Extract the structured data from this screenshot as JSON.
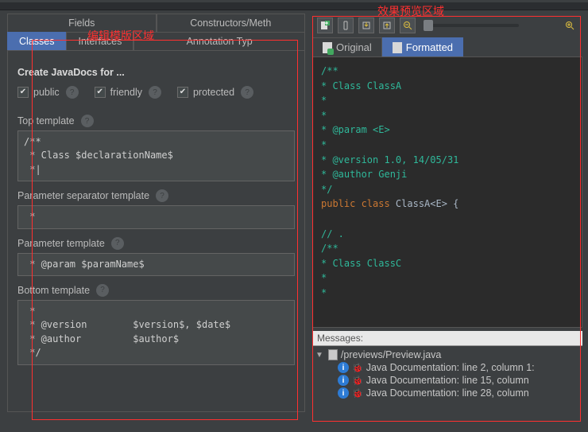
{
  "annotations": {
    "left": "编辑模版区域",
    "right": "效果预览区域"
  },
  "leftTabsRow1": {
    "fields": "Fields",
    "constructors": "Constructors/Meth"
  },
  "leftTabsRow2": {
    "classes": "Classes",
    "interfaces": "Interfaces",
    "annotation": "Annotation Typ"
  },
  "form": {
    "heading": "Create JavaDocs for ...",
    "checks": {
      "public": "public",
      "friendly": "friendly",
      "protected": "protected"
    },
    "labels": {
      "top": "Top template",
      "paramSep": "Parameter separator template",
      "param": "Parameter template",
      "bottom": "Bottom template"
    },
    "code": {
      "top": "/**\n * Class $declarationName$\n *|",
      "paramSep": " *",
      "param": " * @param $paramName$",
      "bottom": " *\n * @version        $version$, $date$\n * @author         $author$\n */"
    }
  },
  "rightTabs": {
    "original": "Original",
    "formatted": "Formatted"
  },
  "preview": {
    "l1": "/**",
    "l2": " * Class ClassA",
    "l3": " *",
    "l4": " *",
    "l5": " * @param <E>",
    "l6": " *",
    "l7": " * @version        1.0, 14/05/31",
    "l8": " * @author         Genji",
    "l9": " */",
    "decl_kw": "public class ",
    "decl_name": "ClassA<E> {",
    "l11": "    // .",
    "l12": "",
    "l13": "    /**",
    "l14": "     * Class ClassC",
    "l15": "     *",
    "l16": "     *"
  },
  "messages": {
    "header": "Messages:",
    "file": "/previews/Preview.java",
    "m1": "Java Documentation: line 2, column 1:",
    "m2": "Java Documentation: line 15, column",
    "m3": "Java Documentation: line 28, column"
  }
}
